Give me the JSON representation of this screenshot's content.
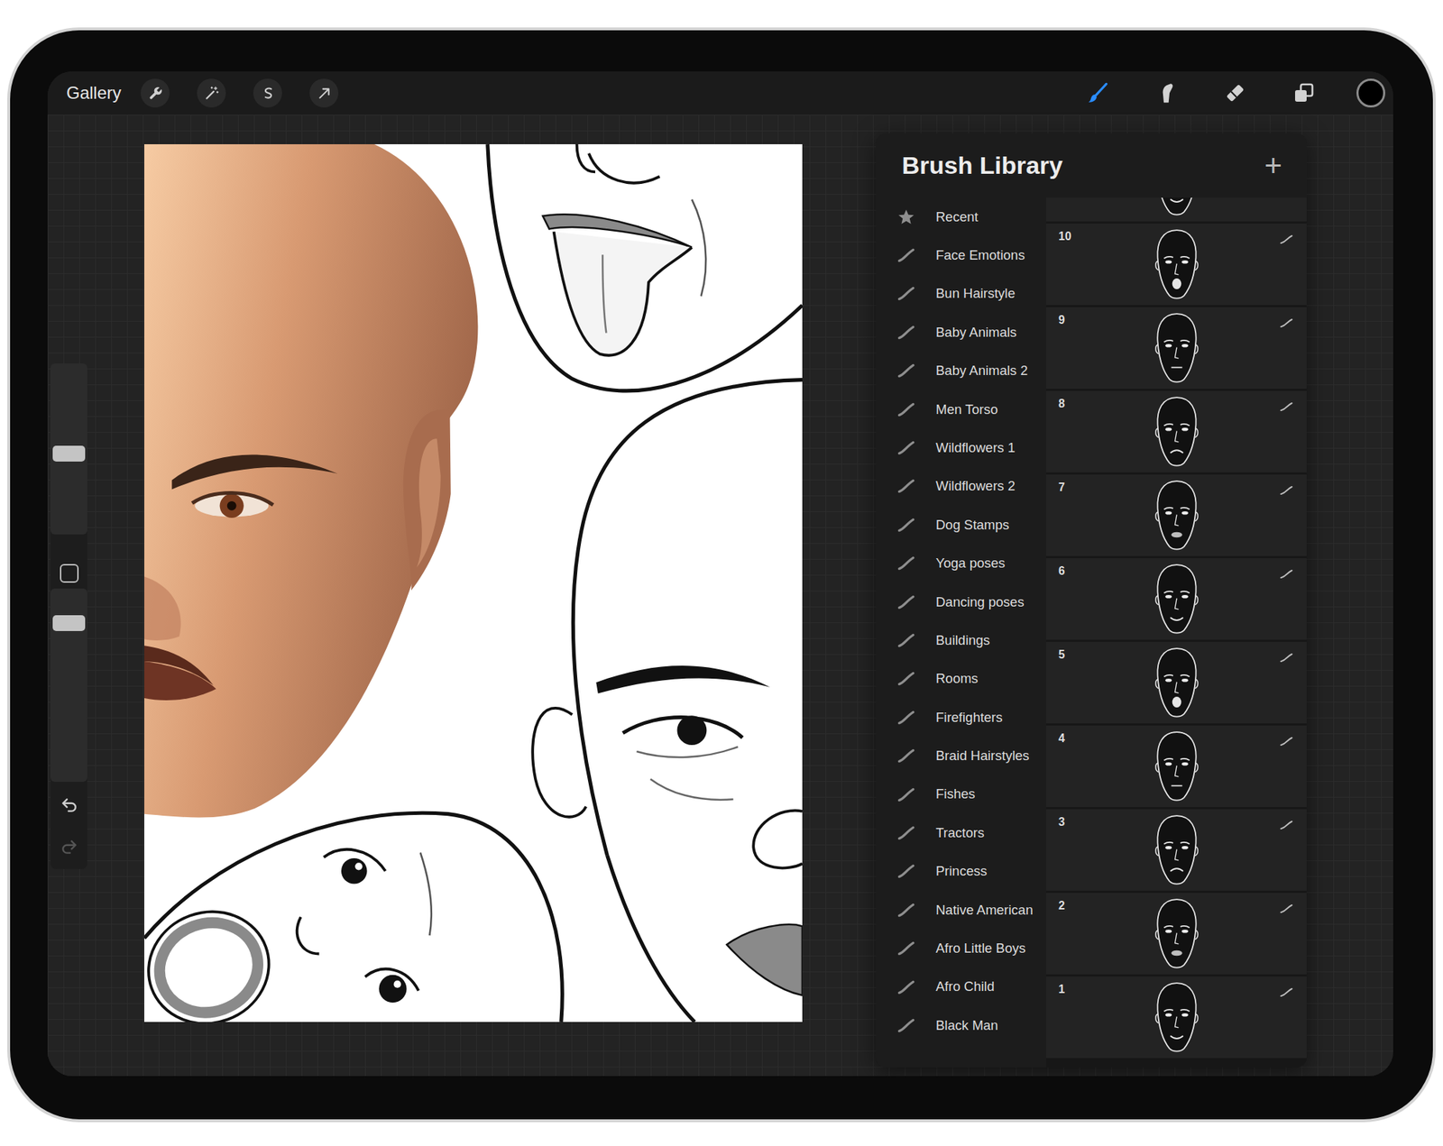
{
  "topbar": {
    "gallery": "Gallery",
    "actions": [
      {
        "kind": "wrench"
      },
      {
        "kind": "wand"
      },
      {
        "kind": "selection"
      },
      {
        "kind": "transform"
      }
    ],
    "tools": [
      {
        "kind": "brush",
        "selected": true
      },
      {
        "kind": "smudge",
        "selected": false
      },
      {
        "kind": "eraser",
        "selected": false
      },
      {
        "kind": "layers",
        "selected": false
      }
    ],
    "color": "#000000"
  },
  "sidebar": {
    "size_level": 0.47,
    "opacity_level": 0.85,
    "undo_enabled": true,
    "redo_enabled": false
  },
  "brush_library": {
    "title": "Brush Library",
    "add": "+",
    "sets": [
      {
        "label": "Recent",
        "kind": "recent",
        "selected": false
      },
      {
        "label": "Face Emotions",
        "kind": "set",
        "selected": false
      },
      {
        "label": "Bun Hairstyle",
        "kind": "set",
        "selected": false
      },
      {
        "label": "Baby Animals",
        "kind": "set",
        "selected": false
      },
      {
        "label": "Baby Animals 2",
        "kind": "set",
        "selected": false
      },
      {
        "label": "Men Torso",
        "kind": "set",
        "selected": false
      },
      {
        "label": "Wildflowers 1",
        "kind": "set",
        "selected": false
      },
      {
        "label": "Wildflowers 2",
        "kind": "set",
        "selected": false
      },
      {
        "label": "Dog Stamps",
        "kind": "set",
        "selected": false
      },
      {
        "label": "Yoga poses",
        "kind": "set",
        "selected": false
      },
      {
        "label": "Dancing poses",
        "kind": "set",
        "selected": false
      },
      {
        "label": "Buildings",
        "kind": "set",
        "selected": false
      },
      {
        "label": "Rooms",
        "kind": "set",
        "selected": false
      },
      {
        "label": "Firefighters",
        "kind": "set",
        "selected": false
      },
      {
        "label": "Braid Hairstyles",
        "kind": "set",
        "selected": false
      },
      {
        "label": "Fishes",
        "kind": "set",
        "selected": false
      },
      {
        "label": "Tractors",
        "kind": "set",
        "selected": false
      },
      {
        "label": "Princess",
        "kind": "set",
        "selected": false
      },
      {
        "label": "Native American",
        "kind": "set",
        "selected": false
      },
      {
        "label": "Afro Little Boys",
        "kind": "set",
        "selected": false
      },
      {
        "label": "Afro Child",
        "kind": "set",
        "selected": false
      },
      {
        "label": "Black Man",
        "kind": "set",
        "selected": false
      }
    ],
    "brushes": [
      {
        "number": "10",
        "selected": false
      },
      {
        "number": "9",
        "selected": false
      },
      {
        "number": "8",
        "selected": false
      },
      {
        "number": "7",
        "selected": false
      },
      {
        "number": "6",
        "selected": false
      },
      {
        "number": "5",
        "selected": false
      },
      {
        "number": "4",
        "selected": false
      },
      {
        "number": "3",
        "selected": false
      },
      {
        "number": "2",
        "selected": false
      },
      {
        "number": "1",
        "selected": false
      }
    ]
  }
}
